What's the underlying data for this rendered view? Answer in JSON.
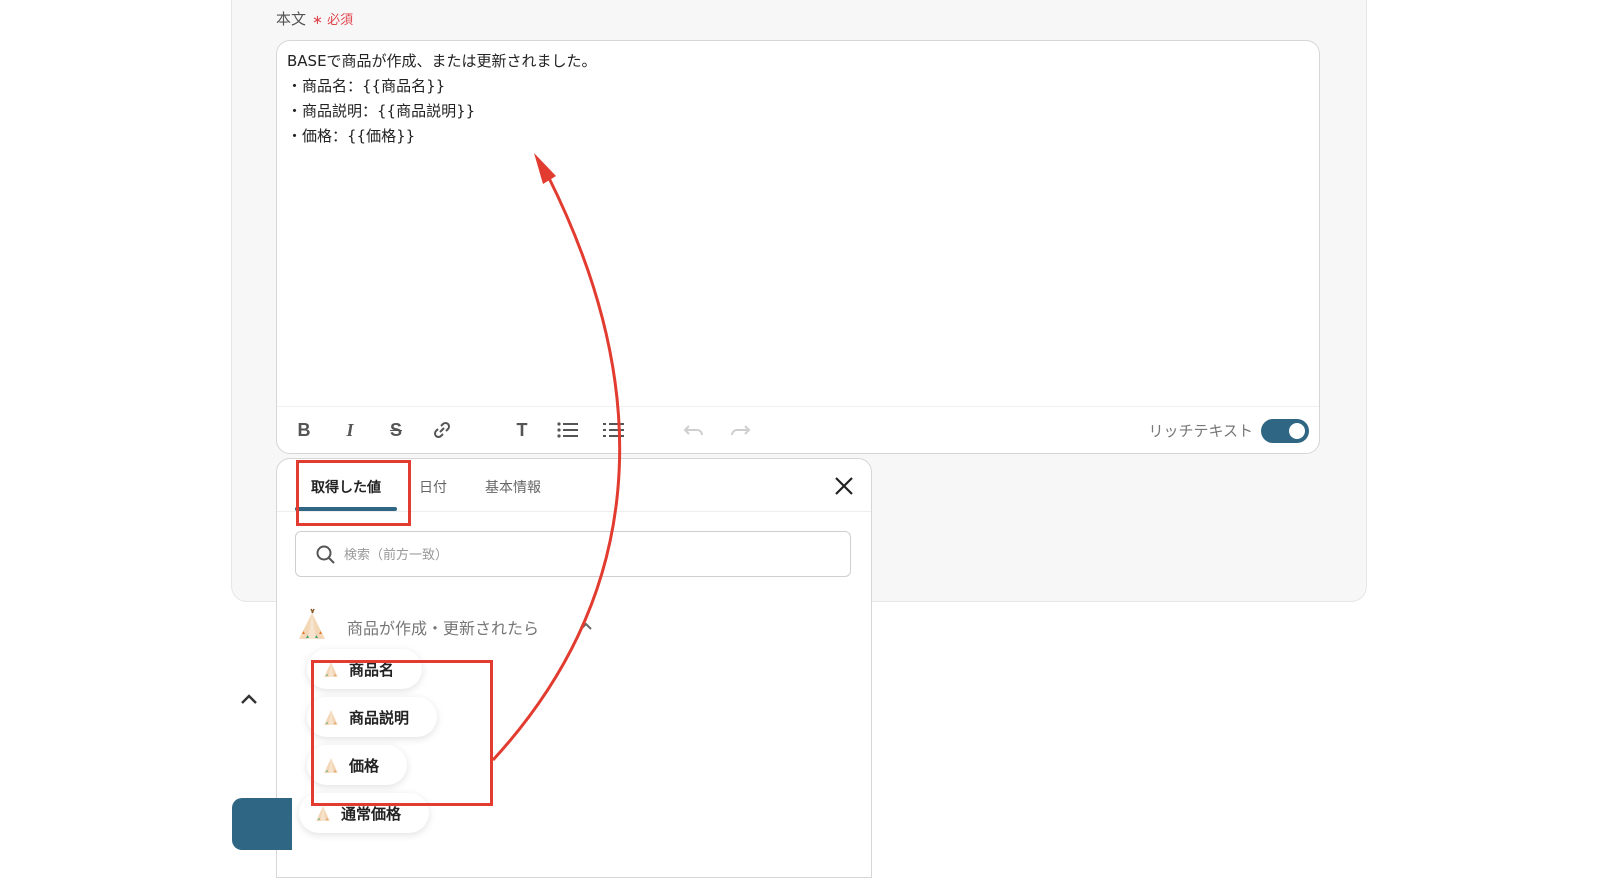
{
  "field": {
    "label": "本文",
    "required_mark": "∗",
    "required_text": "必須"
  },
  "editor": {
    "lines": [
      "BASEで商品が作成、または更新されました。",
      "・商品名：{{商品名}}",
      "・商品説明：{{商品説明}}",
      "・価格：{{価格}}"
    ],
    "toolbar": {
      "bold": "B",
      "italic": "I",
      "strike": "S",
      "heading": "T",
      "rich_text_label": "リッチテキスト",
      "rich_text_enabled": true
    }
  },
  "panel": {
    "tabs": [
      {
        "label": "取得した値",
        "active": true
      },
      {
        "label": "日付",
        "active": false
      },
      {
        "label": "基本情報",
        "active": false
      }
    ],
    "search_placeholder": "検索（前方一致）",
    "group_title": "商品が作成・更新されたら",
    "items": [
      "商品名",
      "商品説明",
      "価格",
      "通常価格"
    ]
  },
  "colors": {
    "accent": "#2e6683",
    "highlight": "#e23b30",
    "required": "#e0464e"
  }
}
